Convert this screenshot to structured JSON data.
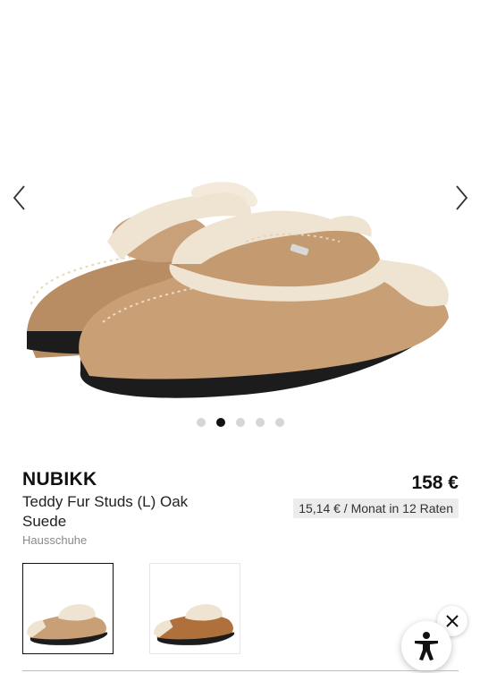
{
  "product": {
    "brand": "NUBIKK",
    "name": "Teddy Fur Studs (L) Oak Suede",
    "category": "Hausschuhe",
    "price": "158 €",
    "installment": "15,14 € / Monat in 12 Raten",
    "colors": {
      "suede": "#c99f76",
      "fur": "#efe3d1",
      "sole": "#1c1c1c",
      "variant_brown": "#b0703b"
    }
  },
  "gallery": {
    "dots_count": 5,
    "active_dot": 2,
    "prev_icon": "chevron-left-icon",
    "next_icon": "chevron-right-icon"
  },
  "variants": [
    {
      "color_name": "oak",
      "selected": true
    },
    {
      "color_name": "brown",
      "selected": false
    }
  ],
  "widgets": {
    "close_icon": "close-icon",
    "accessibility_icon": "accessibility-icon"
  }
}
